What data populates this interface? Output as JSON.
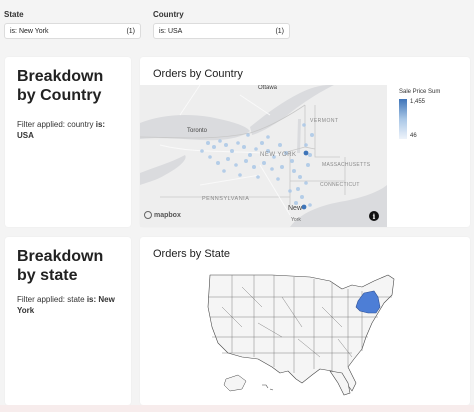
{
  "filters": {
    "state": {
      "label": "State",
      "value": "is: New York",
      "count": "(1)"
    },
    "country": {
      "label": "Country",
      "value": "is: USA",
      "count": "(1)"
    }
  },
  "breakdown_country": {
    "title": "Breakdown by Country",
    "filter_prefix": "Filter applied: country",
    "filter_op": "is:",
    "filter_value": "USA"
  },
  "breakdown_state": {
    "title": "Breakdown by state",
    "filter_prefix": "Filter applied: state",
    "filter_op": "is:",
    "filter_value": "New York"
  },
  "orders_by_country": {
    "title": "Orders by Country",
    "legend_title": "Sale Price Sum",
    "legend_max": "1,455",
    "legend_min": "46",
    "map_labels": {
      "ottawa": "Ottawa",
      "toronto": "Toronto",
      "vermont": "VERMONT",
      "new_york": "NEW YORK",
      "massachusetts": "MASSACHUSETTS",
      "connecticut": "CONNECTICUT",
      "pennsylvania": "PENNSYLVANIA",
      "new_city": "New",
      "york_city": "York"
    },
    "attribution": "mapbox",
    "info_glyph": "i",
    "point_color": "#a9c7e6",
    "point_color_max": "#3e74b8"
  },
  "orders_by_state": {
    "title": "Orders by State",
    "highlight_color": "#4d7ed6",
    "highlight_state": "New York"
  }
}
